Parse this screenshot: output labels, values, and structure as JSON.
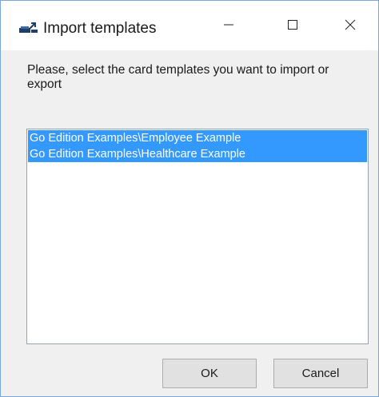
{
  "window": {
    "title": "Import templates",
    "icon": "import-templates-app-icon",
    "controls": {
      "minimize": "minimize-icon",
      "maximize": "maximize-icon",
      "close": "close-icon"
    }
  },
  "prompt": "Please, select the card templates you want to import or export",
  "templates": [
    {
      "label": "Go Edition Examples\\Employee Example",
      "selected": true
    },
    {
      "label": "Go Edition Examples\\Healthcare Example",
      "selected": true
    }
  ],
  "buttons": {
    "ok": "OK",
    "cancel": "Cancel"
  },
  "colors": {
    "selection": "#3399ff",
    "window_border": "#7aa7d8",
    "dialog_background": "#f0f0f0"
  }
}
